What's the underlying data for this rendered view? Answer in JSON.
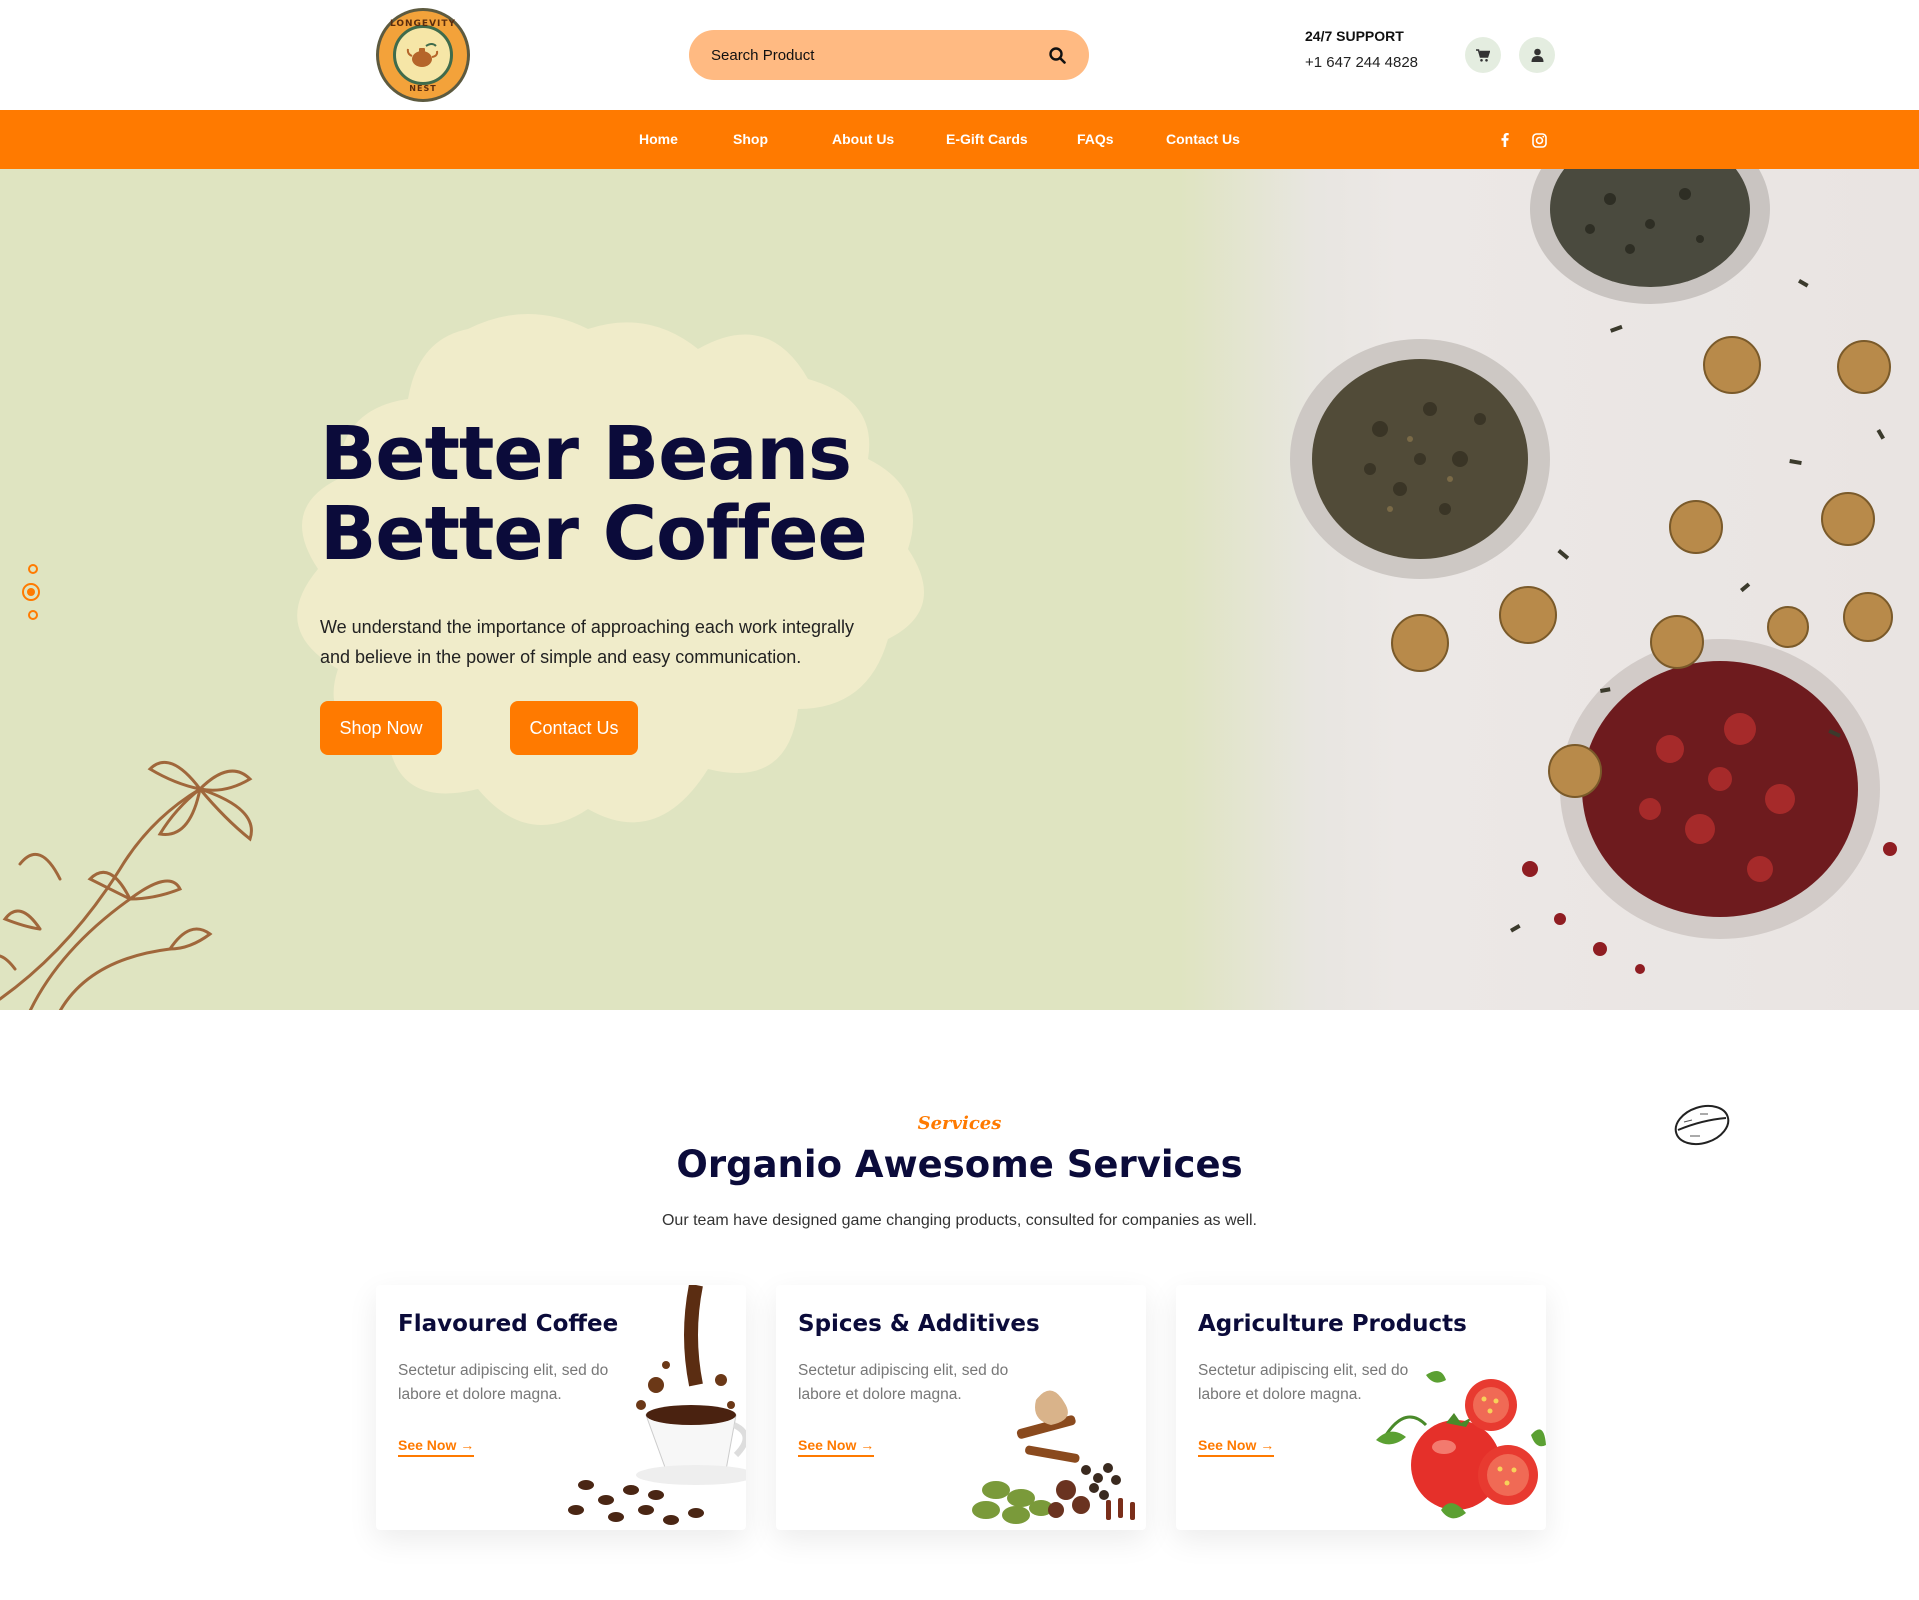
{
  "brand": {
    "logo_top": "LONGEVITY",
    "logo_bottom": "NEST"
  },
  "search": {
    "placeholder": "Search Product"
  },
  "support": {
    "label": "24/7 SUPPORT",
    "phone": "+1 647 244 4828"
  },
  "header_icons": {
    "cart": "cart-icon",
    "user": "user-icon"
  },
  "nav": {
    "items": [
      "Home",
      "Shop",
      "About Us",
      "E-Gift Cards",
      "FAQs",
      "Contact Us"
    ],
    "social": [
      "facebook-icon",
      "instagram-icon"
    ]
  },
  "hero": {
    "title_line1": "Better Beans",
    "title_line2": "Better Coffee",
    "description": "We understand the importance of approaching each work integrally and believe in the power of simple and easy communication.",
    "btn_primary": "Shop Now",
    "btn_secondary": "Contact Us"
  },
  "services": {
    "subtitle": "Services",
    "title": "Organio Awesome Services",
    "description": "Our team have designed game changing products, consulted for companies as well.",
    "cards": [
      {
        "title": "Flavoured Coffee",
        "text": "Sectetur adipiscing elit, sed do labore et dolore magna.",
        "link": "See Now →"
      },
      {
        "title": "Spices & Additives",
        "text": "Sectetur adipiscing elit, sed do labore et dolore magna.",
        "link": "See Now →"
      },
      {
        "title": "Agriculture Products",
        "text": "Sectetur adipiscing elit, sed do labore et dolore magna.",
        "link": "See Now →"
      }
    ]
  },
  "colors": {
    "accent": "#ff7a00",
    "hero_bg": "#dfe4c1",
    "heading": "#0b0b3a",
    "search_bg": "#ffba82"
  }
}
